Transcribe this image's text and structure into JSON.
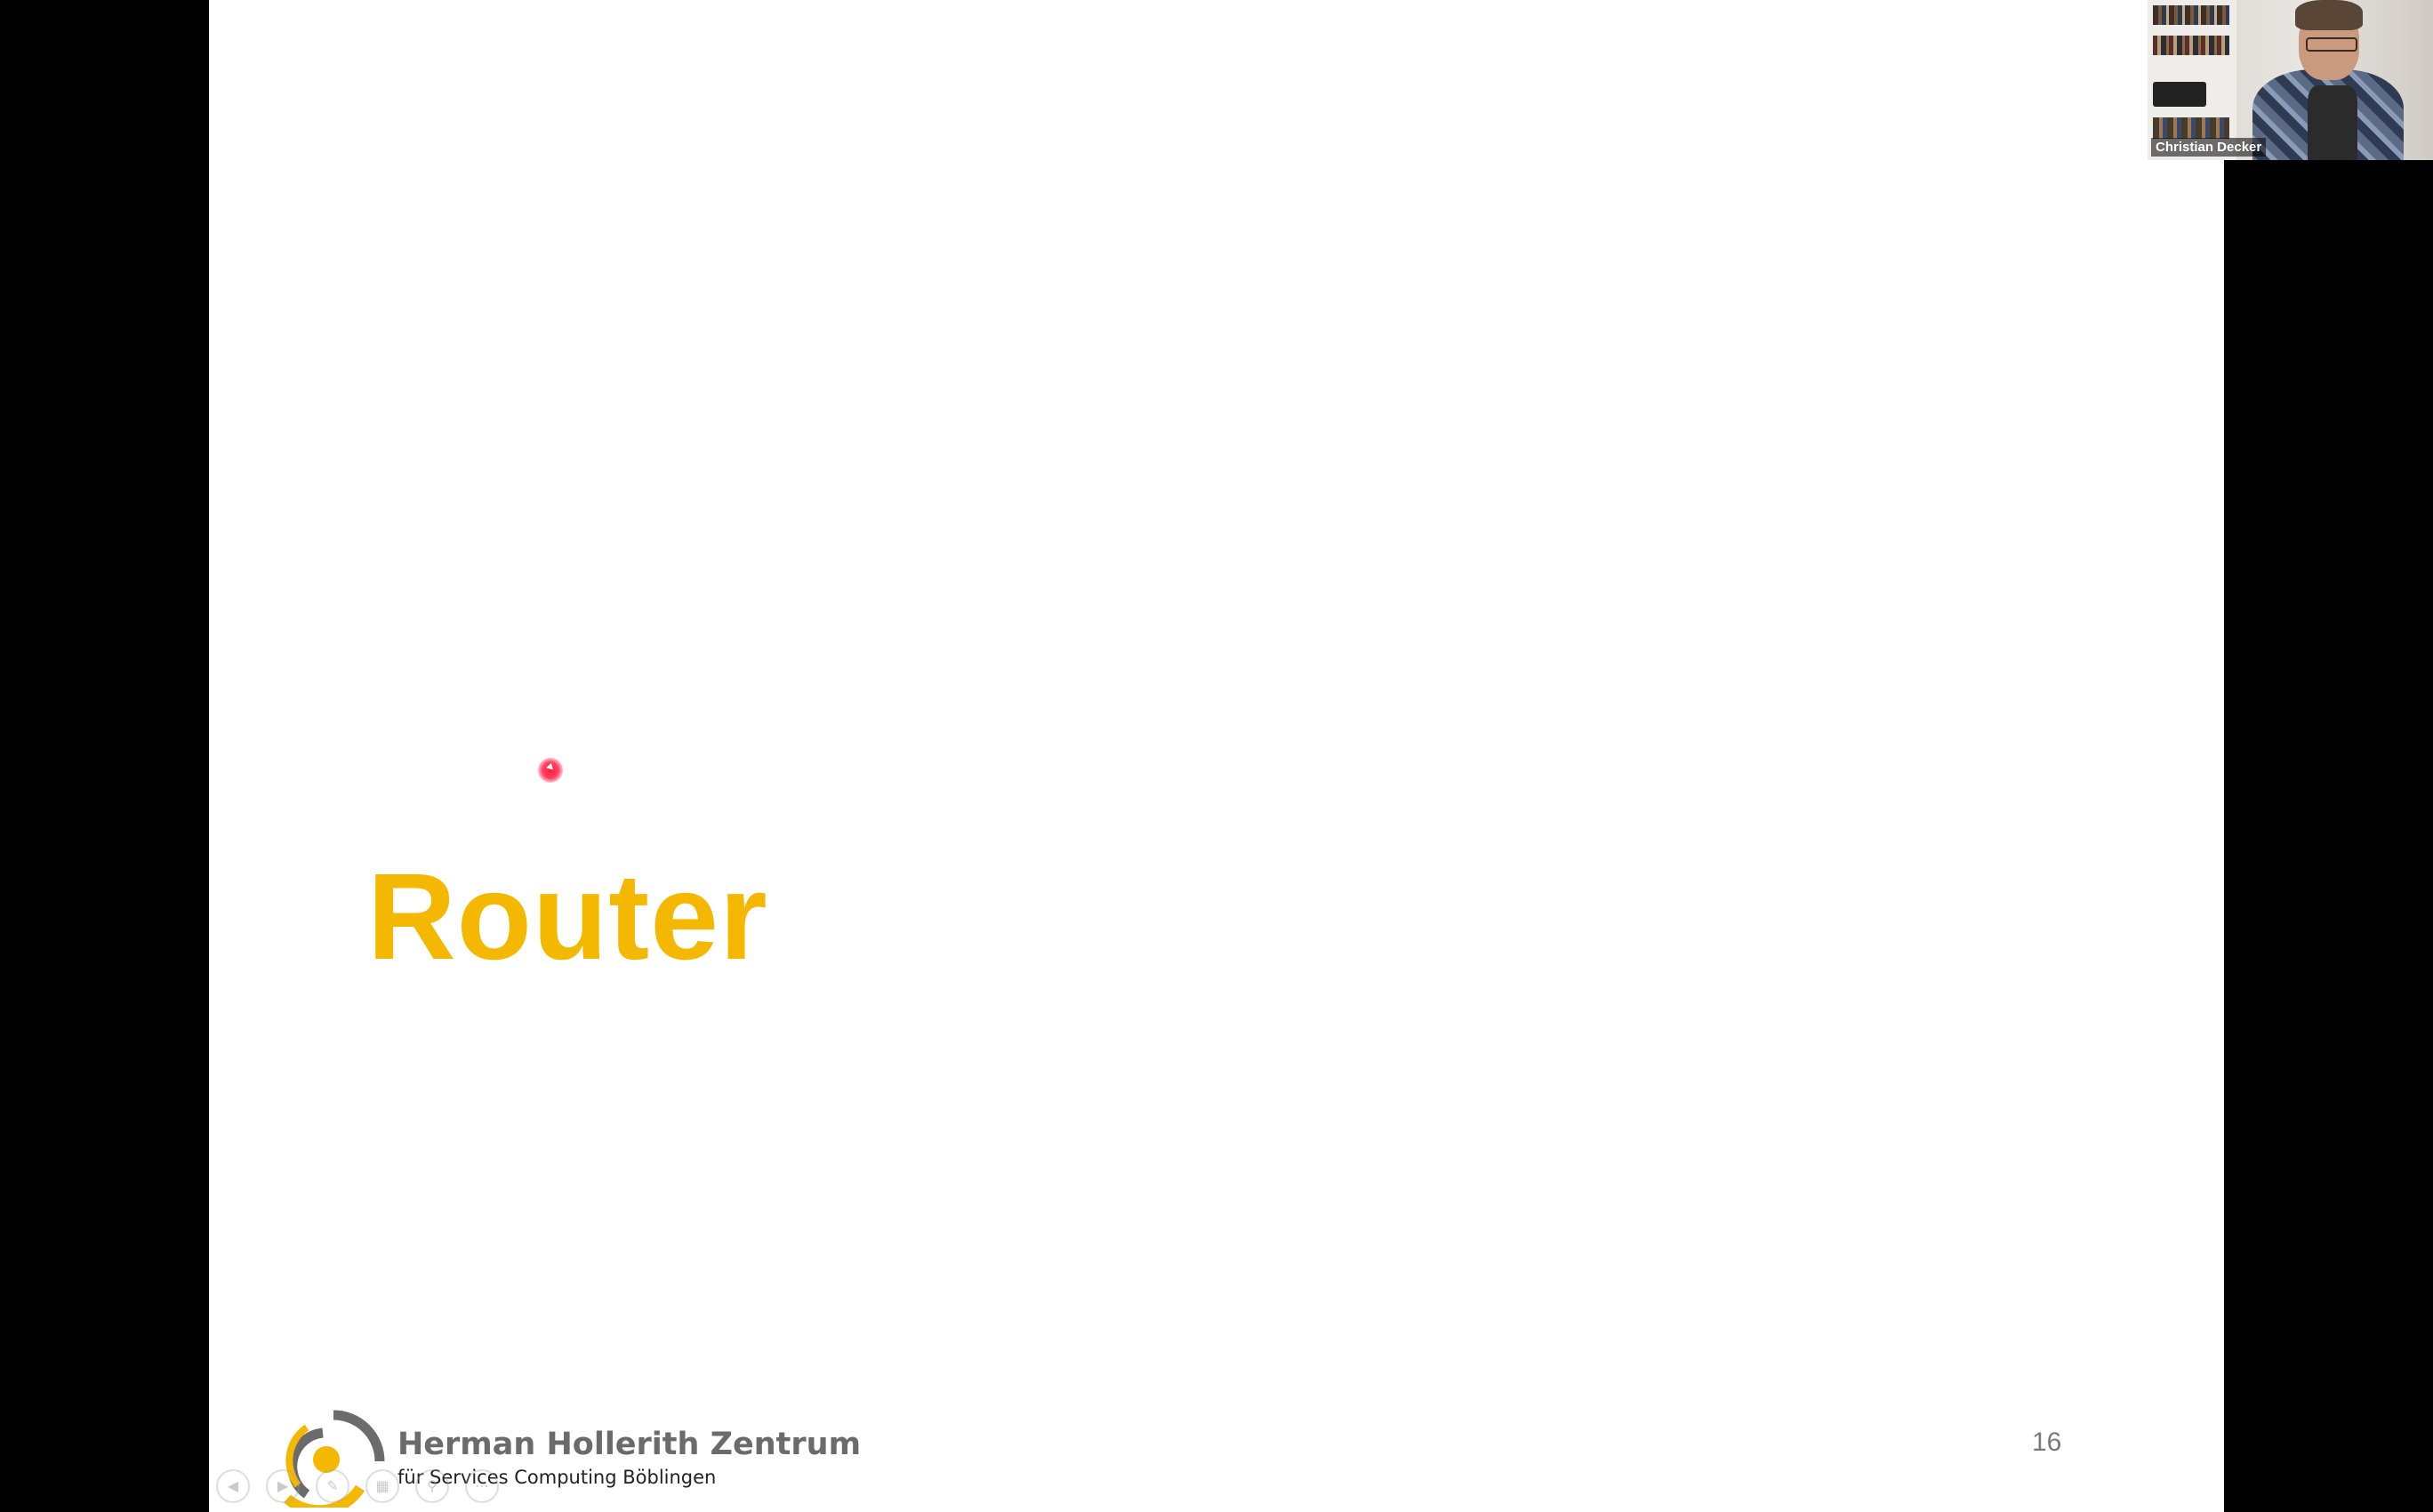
{
  "slide": {
    "title": "Router",
    "page_number": "16",
    "footer": {
      "org_name": "Herman Hollerith Zentrum",
      "org_subtitle": "für Services Computing Böblingen"
    }
  },
  "colors": {
    "title": "#f4b800",
    "logo_yellow": "#f4b800",
    "logo_grey": "#6b6b6b",
    "laser_pointer": "#ff1e3c",
    "letterbox": "#000000"
  },
  "presentation_controls": [
    {
      "icon": "previous-icon"
    },
    {
      "icon": "next-icon"
    },
    {
      "icon": "pen-icon"
    },
    {
      "icon": "slides-grid-icon"
    },
    {
      "icon": "zoom-icon"
    },
    {
      "icon": "more-icon"
    }
  ],
  "video_call": {
    "participant_name": "Christian Decker"
  }
}
